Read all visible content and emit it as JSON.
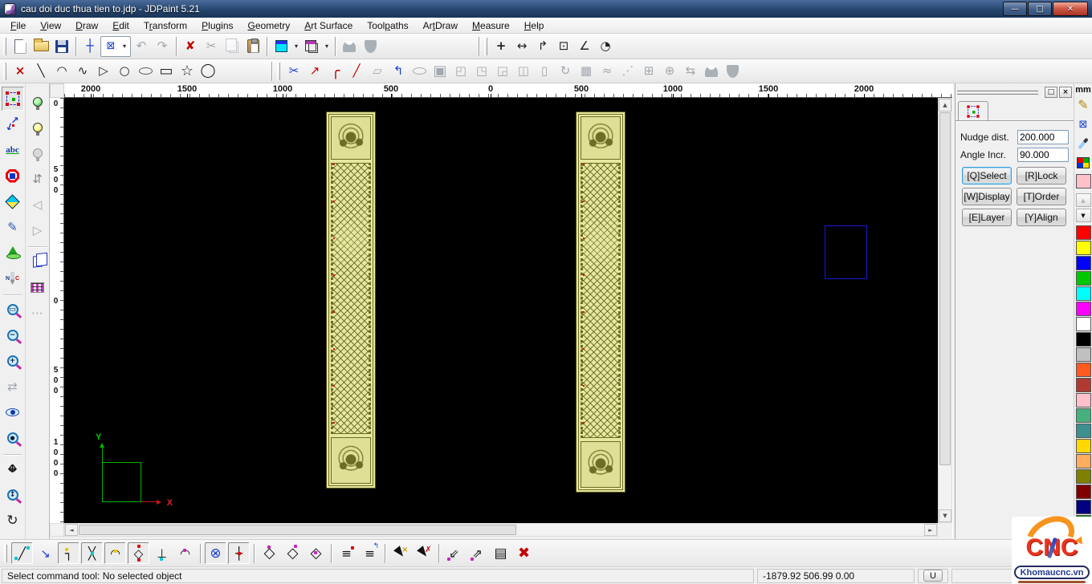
{
  "window": {
    "title": "cau doi duc thua tien to.jdp - JDPaint 5.21",
    "min": "—",
    "max": "□",
    "close": "✕"
  },
  "menu": {
    "items": [
      {
        "pre": "",
        "u": "F",
        "post": "ile"
      },
      {
        "pre": "",
        "u": "V",
        "post": "iew"
      },
      {
        "pre": "",
        "u": "D",
        "post": "raw"
      },
      {
        "pre": "",
        "u": "E",
        "post": "dit"
      },
      {
        "pre": "T",
        "u": "r",
        "post": "ansform"
      },
      {
        "pre": "",
        "u": "P",
        "post": "lugins"
      },
      {
        "pre": "",
        "u": "G",
        "post": "eometry"
      },
      {
        "pre": "",
        "u": "A",
        "post": "rt Surface"
      },
      {
        "pre": "Tool",
        "u": "p",
        "post": "aths"
      },
      {
        "pre": "Ar",
        "u": "t",
        "post": "Draw"
      },
      {
        "pre": "",
        "u": "M",
        "post": "easure"
      },
      {
        "pre": "",
        "u": "H",
        "post": "elp"
      }
    ]
  },
  "icons": {
    "dropdown": "▾",
    "crosshair": "┼",
    "select_box": "⊠",
    "undo": "↶",
    "redo": "↷",
    "delete_x": "✘",
    "cut": "✂",
    "m_point": "+",
    "m_dist": "↔",
    "m_path": "↱",
    "m_rect": "⊡",
    "m_angle": "∠",
    "m_circle": "◔",
    "d_point": "×",
    "d_line": "╲",
    "d_arc": "◠",
    "d_spline": "∿",
    "d_poly": "▷",
    "d_circle": "○",
    "d_rect": "▭",
    "d_star": "☆",
    "d_ngon": "◯",
    "e_trim": "✂",
    "e_extend": "↗",
    "e_fillet": "╭",
    "e_chamfer": "╱",
    "e_offset": "↰",
    "gray_row": [
      "▱",
      "▣",
      "◰",
      "◳",
      "◲",
      "◫",
      "▯",
      "↻",
      "▦",
      "≈",
      "⋰",
      "⊞",
      "⊕",
      "⇆"
    ],
    "swap": "⇵",
    "flag_l": "◁",
    "flag_r": "▷",
    "tree": "⋯",
    "redraw": "⇄",
    "refresh": "↻",
    "pan_h": "↔",
    "pan_v": "↕",
    "z_win": "▭",
    "z_out": "−",
    "z_in": "+",
    "z_dyn": "↕",
    "z_obj": "●",
    "pencil": "✎",
    "up": "▲",
    "down": "▼",
    "left_arrow": "◄",
    "right_arrow": "►",
    "panel_restore": "□",
    "panel_close": "×",
    "snap": {
      "line": "╱",
      "arrows": "↘",
      "corner": "┐",
      "cross": "╳",
      "arc": "◠",
      "quad": "◇",
      "perp": "⊥",
      "tan": "◠",
      "grid": "⊗",
      "axis": "┼",
      "face": "◇",
      "stack": "≡",
      "skew": "⇙",
      "pt": "⇗",
      "list": "▤",
      "del": "✖",
      "cursor_x": "×",
      "cursor_redx": "✗"
    }
  },
  "tools": {
    "text_tool": "abc",
    "drill_n": "N",
    "drill_c": "C"
  },
  "rulers": {
    "unit": "mm",
    "h_labels": [
      "2000",
      "1500",
      "1000",
      "500",
      "0",
      "500",
      "1000",
      "1500",
      "2000"
    ],
    "v_labels": [
      "0",
      "500",
      "0",
      "500",
      "1000"
    ]
  },
  "panel": {
    "fields": [
      {
        "label": "Nudge dist.",
        "value": "200.000"
      },
      {
        "label": "Angle Incr.",
        "value": "90.000"
      }
    ],
    "buttons": [
      {
        "label": "[Q]Select"
      },
      {
        "label": "[R]Lock"
      },
      {
        "label": "[W]Display"
      },
      {
        "label": "[T]Order"
      },
      {
        "label": "[E]Layer"
      },
      {
        "label": "[Y]Align"
      }
    ]
  },
  "palette": {
    "current": "#FFC0CB",
    "swatches": [
      "#FF0000",
      "#FFFF00",
      "#0000FF",
      "#00C800",
      "#00FFFF",
      "#FF00FF",
      "#FFFFFF",
      "#000000",
      "#C0C0C0",
      "#FF5A1E",
      "#B03A32",
      "#FFC0CB",
      "#46B07E",
      "#3E8F8F",
      "#FFD800",
      "#FFAE5F",
      "#808000",
      "#800000",
      "#000080",
      "#008000",
      "#008080",
      "#800080"
    ]
  },
  "canvas": {
    "x_label": "X",
    "y_label": "Y"
  },
  "statusbar": {
    "message": "Select command tool: No selected object",
    "coords": "-1879.92 506.99 0.00",
    "unit_button": "U"
  },
  "logo": {
    "brand": "CNC",
    "site": "Khomaucnc.vn"
  }
}
